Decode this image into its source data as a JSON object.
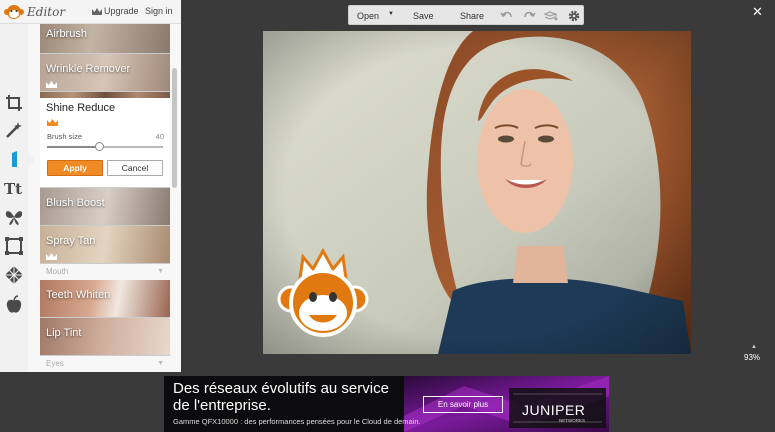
{
  "header": {
    "app_name": "Editor",
    "upgrade": "Upgrade",
    "signin": "Sign in"
  },
  "toolbar": {
    "open": "Open",
    "save": "Save",
    "share": "Share"
  },
  "effects": {
    "airbrush": "Airbrush",
    "wrinkle": "Wrinkle Remover",
    "shine": "Shine Reduce",
    "blush": "Blush Boost",
    "spray": "Spray Tan",
    "teeth": "Teeth Whiten",
    "lip": "Lip Tint"
  },
  "sections": {
    "mouth": "Mouth",
    "eyes": "Eyes"
  },
  "shine_panel": {
    "brush_size_label": "Brush size",
    "brush_size_value": "40",
    "brush_fraction": 0.45,
    "apply": "Apply",
    "cancel": "Cancel"
  },
  "zoom": "93%",
  "ad": {
    "line1": "Des réseaux évolutifs au service",
    "line2": "de l'entreprise.",
    "small": "Gamme QFX10000 : des performances pensées pour le Cloud de demain.",
    "button": "En savoir plus",
    "brand": "JUNIPER",
    "brand_sub": "NETWORKS"
  },
  "colors": {
    "accent": "#f08a24",
    "background": "#3a3a3a"
  },
  "icons": [
    "crop-icon",
    "magic-wand-icon",
    "lipstick-icon",
    "text-icon",
    "butterfly-icon",
    "frame-icon",
    "texture-icon",
    "apple-icon",
    "undo-icon",
    "redo-icon",
    "layers-icon",
    "gear-icon",
    "close-icon"
  ]
}
